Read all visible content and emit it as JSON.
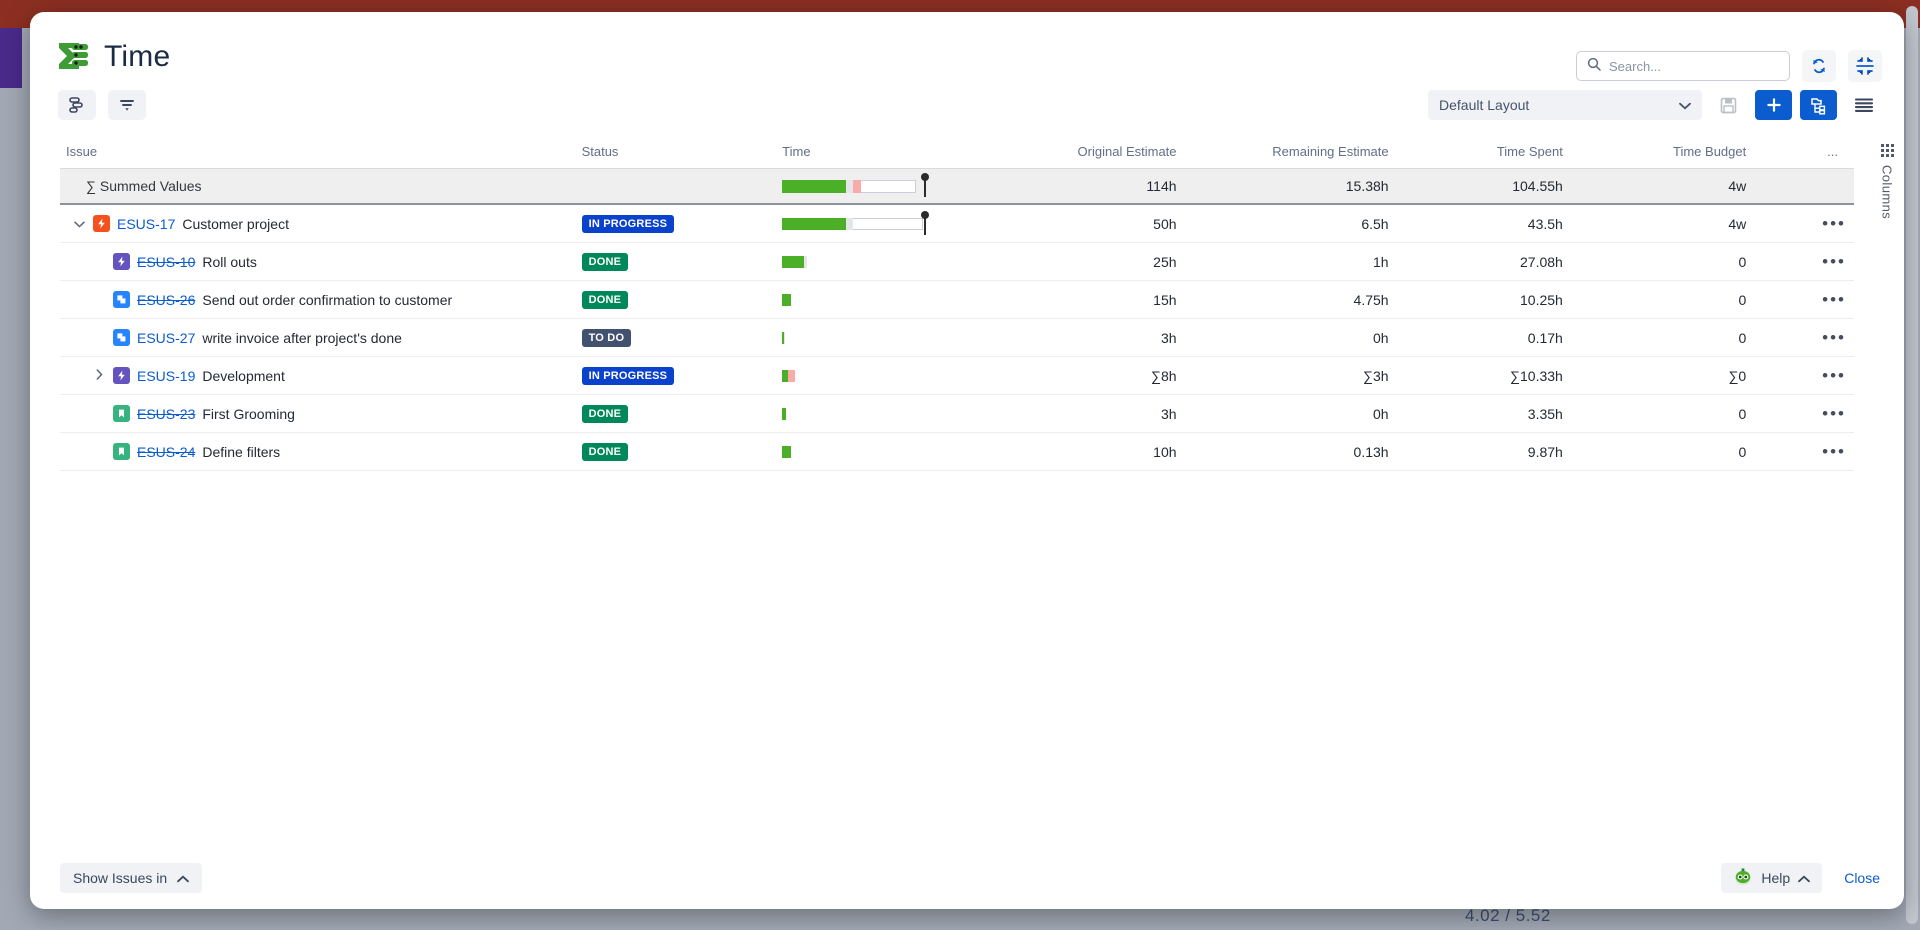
{
  "window": {
    "app_title": "Time",
    "logo_icon": "sigma-table-icon"
  },
  "header": {
    "search": {
      "placeholder": "Search...",
      "value": "",
      "icon": "search-icon"
    },
    "refresh_icon": "refresh-sync-icon",
    "collapse_icon": "collapse-fullscreen-icon"
  },
  "toolbar": {
    "structure_icon": "structure-gantt-icon",
    "filter_icon": "filter-funnel-icon",
    "layout_selected": "Default Layout",
    "layout_chevron": "chevron-down-icon",
    "save_icon": "floppy-save-icon",
    "add_icon": "plus-icon",
    "hierarchy_icon": "hierarchy-tree-icon",
    "list_icon": "list-lines-icon"
  },
  "columns_rail": {
    "label": "Columns",
    "icon": "grid-dots-icon"
  },
  "table": {
    "headers": [
      "Issue",
      "Status",
      "Time",
      "Original Estimate",
      "Remaining Estimate",
      "Time Spent",
      "Time Budget",
      "..."
    ],
    "summed_row": {
      "label": "∑ Summed Values",
      "original_estimate": "114h",
      "remaining_estimate": "15.38h",
      "time_spent": "104.55h",
      "time_budget": "4w"
    },
    "rows": [
      {
        "indent": 0,
        "toggle": "expanded",
        "icon": "epic-red-icon",
        "icon_color": "#F4511E",
        "key": "ESUS-17",
        "key_struck": false,
        "summary": "Customer project",
        "status": "IN PROGRESS",
        "status_color": "#0b42cc",
        "original_estimate": "50h",
        "remaining_estimate": "6.5h",
        "time_spent": "43.5h",
        "time_budget": "4w",
        "bar": {
          "green": 48,
          "gray": 5,
          "pink": 0,
          "white": 52,
          "pin": true,
          "width": 134
        },
        "menu": "row-menu-icon"
      },
      {
        "indent": 1,
        "toggle": "none",
        "icon": "epic-purple-icon",
        "icon_color": "#6554C0",
        "key": "ESUS-10",
        "key_struck": true,
        "summary": "Roll outs",
        "status": "DONE",
        "status_color": "#00875A",
        "original_estimate": "25h",
        "remaining_estimate": "1h",
        "time_spent": "27.08h",
        "time_budget": "0",
        "bar": {
          "green": 88,
          "gray": 12,
          "pink": 0,
          "white": 0,
          "pin": false,
          "width": 25
        },
        "menu": "row-menu-icon"
      },
      {
        "indent": 1,
        "toggle": "none",
        "icon": "task-blue-icon",
        "icon_color": "#2684FF",
        "key": "ESUS-26",
        "key_struck": true,
        "summary": "Send out order confirmation to customer",
        "status": "DONE",
        "status_color": "#00875A",
        "original_estimate": "15h",
        "remaining_estimate": "4.75h",
        "time_spent": "10.25h",
        "time_budget": "0",
        "bar": {
          "green": 100,
          "gray": 0,
          "pink": 0,
          "white": 0,
          "pin": false,
          "width": 9
        },
        "menu": "row-menu-icon"
      },
      {
        "indent": 1,
        "toggle": "none",
        "icon": "task-blue-icon",
        "icon_color": "#2684FF",
        "key": "ESUS-27",
        "key_struck": false,
        "summary": "write invoice after project's done",
        "status": "TO DO",
        "status_color": "#42526E",
        "original_estimate": "3h",
        "remaining_estimate": "0h",
        "time_spent": "0.17h",
        "time_budget": "0",
        "bar": {
          "green": 55,
          "gray": 45,
          "pink": 0,
          "white": 0,
          "pin": false,
          "width": 3
        },
        "menu": "row-menu-icon"
      },
      {
        "indent": 1,
        "toggle": "collapsed",
        "icon": "epic-purple-icon",
        "icon_color": "#6554C0",
        "key": "ESUS-19",
        "key_struck": false,
        "summary": "Development",
        "status": "IN PROGRESS",
        "status_color": "#0b42cc",
        "original_estimate": "∑8h",
        "remaining_estimate": "∑3h",
        "time_spent": "∑10.33h",
        "time_budget": "∑0",
        "bar": {
          "green": 48,
          "gray": 0,
          "pink": 52,
          "white": 0,
          "pin": false,
          "width": 13
        },
        "menu": "row-menu-icon"
      },
      {
        "indent": 1,
        "toggle": "none",
        "icon": "story-green-icon",
        "icon_color": "#36B37E",
        "key": "ESUS-23",
        "key_struck": true,
        "summary": "First Grooming",
        "status": "DONE",
        "status_color": "#00875A",
        "original_estimate": "3h",
        "remaining_estimate": "0h",
        "time_spent": "3.35h",
        "time_budget": "0",
        "bar": {
          "green": 100,
          "gray": 0,
          "pink": 0,
          "white": 0,
          "pin": false,
          "width": 4
        },
        "menu": "row-menu-icon"
      },
      {
        "indent": 1,
        "toggle": "none",
        "icon": "story-green-icon",
        "icon_color": "#36B37E",
        "key": "ESUS-24",
        "key_struck": true,
        "summary": "Define filters",
        "status": "DONE",
        "status_color": "#00875A",
        "original_estimate": "10h",
        "remaining_estimate": "0.13h",
        "time_spent": "9.87h",
        "time_budget": "0",
        "bar": {
          "green": 100,
          "gray": 0,
          "pink": 0,
          "white": 0,
          "pin": false,
          "width": 9
        },
        "menu": "row-menu-icon"
      }
    ]
  },
  "footer": {
    "show_issues_label": "Show Issues in",
    "show_issues_chevron": "chevron-up-icon",
    "help_label": "Help",
    "help_icon": "help-bot-icon",
    "help_chevron": "chevron-up-icon",
    "close_label": "Close"
  },
  "background": {
    "hidden_text": "4.02 / 5.52"
  },
  "colors": {
    "accent_blue": "#0b5cce",
    "status_progress": "#0b42cc",
    "status_done": "#00875A",
    "status_todo": "#42526E",
    "bar_green": "#4caf28",
    "bar_pink": "#fbaaaa",
    "bar_gray": "#e4e6ea",
    "window_top_band": "#8c2f22",
    "purple_band": "#4a2a8a"
  }
}
